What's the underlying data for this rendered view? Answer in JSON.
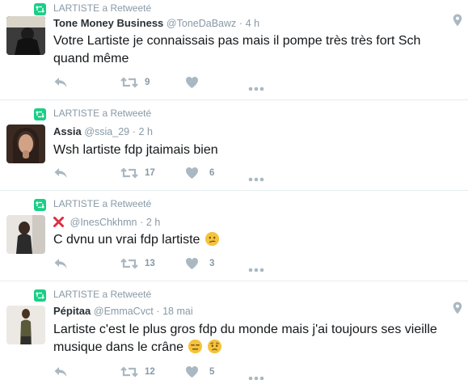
{
  "tweets": [
    {
      "retweeted_by": "LARTISTE a Retweeté",
      "name": "Tone Money Business",
      "handle": "@ToneDaBawz",
      "dot": "·",
      "time": "4 h",
      "text": "Votre Lartiste je connaissais pas mais il pompe très très fort Sch quand même",
      "retweets": "9",
      "likes": "",
      "has_location": true
    },
    {
      "retweeted_by": "LARTISTE a Retweeté",
      "name": "Assia",
      "handle": "@ssia_29",
      "dot": "·",
      "time": "2 h",
      "text": "Wsh lartiste fdp jtaimais bien",
      "retweets": "17",
      "likes": "6",
      "has_location": false
    },
    {
      "retweeted_by": "LARTISTE a Retweeté",
      "name": "",
      "handle": "@InesChkhmn",
      "dot": "·",
      "time": "2 h",
      "text": "C dvnu un vrai fdp lartiste",
      "retweets": "13",
      "likes": "3",
      "has_location": false,
      "name_icon": "red-x-icon",
      "emoji": "confused-face-icon"
    },
    {
      "retweeted_by": "LARTISTE a Retweeté",
      "name": "Pépitaa",
      "handle": "@EmmaCvct",
      "dot": "·",
      "time": "18 mai",
      "text": "Lartiste c'est le plus gros fdp du monde mais j'ai toujours ses vieille musique dans le crâne",
      "retweets": "12",
      "likes": "5",
      "has_location": true,
      "emoji": [
        "expressionless-face-icon",
        "worried-face-icon"
      ]
    }
  ],
  "colors": {
    "retweet_green": "#19cf86",
    "muted": "#8899a6",
    "text": "#14171a",
    "divider": "#e6ecf0",
    "action_icon": "#aab8c2",
    "red_x": "#dd2e44"
  }
}
